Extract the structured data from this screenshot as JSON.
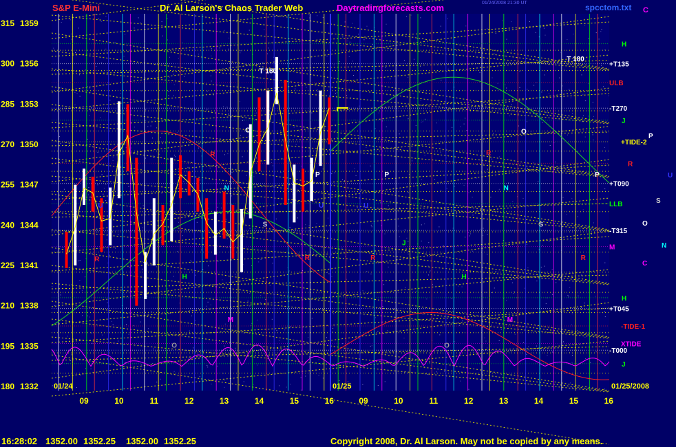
{
  "header": {
    "instrument": "S&P E-Mini",
    "title": "Dr. Al Larson's Chaos Trader Web",
    "site": "Daytradingforecasts.com",
    "timestamp": "01/24/2008 21:30 UT",
    "file": "spcctom.txt",
    "corner_letter": "C"
  },
  "footer": {
    "time": "16:28:02",
    "open": "1352.00",
    "high": "1352.25",
    "low": "1352.00",
    "close": "1352.25",
    "copyright": "Copyright 2008, Dr. Al Larson. May not be copied by any means."
  },
  "chart_data": {
    "type": "line",
    "y_axis_degree_labels": [
      "315",
      "300",
      "285",
      "270",
      "255",
      "240",
      "225",
      "210",
      "195",
      "180"
    ],
    "y_axis_price_labels": [
      "1359",
      "1356",
      "1353",
      "1350",
      "1347",
      "1344",
      "1341",
      "1338",
      "1335",
      "1332"
    ],
    "ylim": [
      1332,
      1359
    ],
    "x_tick_labels_day1": [
      "09",
      "10",
      "11",
      "12",
      "13",
      "14",
      "15",
      "16"
    ],
    "x_tick_labels_day2": [
      "09",
      "10",
      "11",
      "12",
      "13",
      "14",
      "15",
      "16"
    ],
    "date_labels": [
      "01/24",
      "01/25",
      "01/25/2008"
    ],
    "right_levels": [
      {
        "label": "H",
        "price": 1357.5,
        "color": "#00ff00"
      },
      {
        "label": "+T135",
        "price": 1356.0,
        "color": "#ffffff"
      },
      {
        "label": "ULB",
        "price": 1354.6,
        "color": "#ff2020"
      },
      {
        "label": "-T270",
        "price": 1352.7,
        "color": "#ffffff"
      },
      {
        "label": "J",
        "price": 1351.8,
        "color": "#00ff00"
      },
      {
        "label": "+TIDE-2",
        "price": 1350.2,
        "color": "#ffff00"
      },
      {
        "label": "R",
        "price": 1348.6,
        "color": "#ff2020"
      },
      {
        "label": "+T090",
        "price": 1347.1,
        "color": "#ffffff"
      },
      {
        "label": "LLB",
        "price": 1345.6,
        "color": "#00ff00"
      },
      {
        "label": "-T315",
        "price": 1343.6,
        "color": "#ffffff"
      },
      {
        "label": "M",
        "price": 1342.4,
        "color": "#ff00ff"
      },
      {
        "label": "H",
        "price": 1338.6,
        "color": "#00ff00"
      },
      {
        "label": "+T045",
        "price": 1337.8,
        "color": "#ffffff"
      },
      {
        "label": "-TIDE-1",
        "price": 1336.5,
        "color": "#ff2020"
      },
      {
        "label": "XTIDE",
        "price": 1335.2,
        "color": "#ff00ff"
      },
      {
        "label": "-T000",
        "price": 1334.7,
        "color": "#ffffff"
      },
      {
        "label": "J",
        "price": 1333.7,
        "color": "#00ff00"
      }
    ],
    "outside_markers": [
      {
        "label": "P",
        "color": "#ffffff"
      },
      {
        "label": "U",
        "color": "#3333ff"
      },
      {
        "label": "S",
        "color": "#cccccc"
      },
      {
        "label": "O",
        "color": "#ffffff"
      },
      {
        "label": "N",
        "color": "#00ffff"
      },
      {
        "label": "C",
        "color": "#ff00ff"
      }
    ],
    "chart_markers": [
      {
        "label": "T 180",
        "day": 1,
        "hour": 14.0,
        "price": 1355.3,
        "color": "#ffffff"
      },
      {
        "label": "T 180",
        "day": 2,
        "hour": 14.8,
        "price": 1356.2,
        "color": "#ffffff"
      },
      {
        "label": "O",
        "day": 1,
        "hour": 13.6,
        "price": 1350.9,
        "color": "#ffffff"
      },
      {
        "label": "O",
        "day": 2,
        "hour": 13.5,
        "price": 1350.8,
        "color": "#ffffff"
      },
      {
        "label": "N",
        "day": 1,
        "hour": 13.0,
        "price": 1346.6,
        "color": "#00ffff"
      },
      {
        "label": "N",
        "day": 2,
        "hour": 13.0,
        "price": 1346.6,
        "color": "#00ffff"
      },
      {
        "label": "P",
        "day": 1,
        "hour": 15.6,
        "price": 1347.6,
        "color": "#ffffff"
      },
      {
        "label": "P",
        "day": 2,
        "hour": 9.6,
        "price": 1347.6,
        "color": "#ffffff"
      },
      {
        "label": "P",
        "day": 2,
        "hour": 15.6,
        "price": 1347.6,
        "color": "#ffffff"
      },
      {
        "label": "S",
        "day": 1,
        "hour": 14.1,
        "price": 1343.9,
        "color": "#cccccc"
      },
      {
        "label": "S",
        "day": 2,
        "hour": 14.0,
        "price": 1343.9,
        "color": "#cccccc"
      },
      {
        "label": "R",
        "day": 1,
        "hour": 9.3,
        "price": 1341.3,
        "color": "#ff2020"
      },
      {
        "label": "R",
        "day": 1,
        "hour": 12.6,
        "price": 1349.1,
        "color": "#ff2020"
      },
      {
        "label": "R",
        "day": 1,
        "hour": 15.3,
        "price": 1341.4,
        "color": "#ff2020"
      },
      {
        "label": "R",
        "day": 2,
        "hour": 9.2,
        "price": 1341.4,
        "color": "#ff2020"
      },
      {
        "label": "R",
        "day": 2,
        "hour": 12.5,
        "price": 1349.2,
        "color": "#ff2020"
      },
      {
        "label": "R",
        "day": 2,
        "hour": 15.2,
        "price": 1341.4,
        "color": "#ff2020"
      },
      {
        "label": "H",
        "day": 1,
        "hour": 11.8,
        "price": 1340.0,
        "color": "#00ff00"
      },
      {
        "label": "H",
        "day": 2,
        "hour": 11.8,
        "price": 1340.0,
        "color": "#00ff00"
      },
      {
        "label": "M",
        "day": 1,
        "hour": 13.1,
        "price": 1336.8,
        "color": "#ff00ff"
      },
      {
        "label": "M",
        "day": 2,
        "hour": 13.1,
        "price": 1336.8,
        "color": "#ff00ff"
      },
      {
        "label": "J",
        "day": 2,
        "hour": 10.1,
        "price": 1342.5,
        "color": "#00ff00"
      },
      {
        "label": "U",
        "day": 1,
        "hour": 9.4,
        "price": 1345.3,
        "color": "#3333ff"
      },
      {
        "label": "U",
        "day": 1,
        "hour": 15.7,
        "price": 1345.3,
        "color": "#3333ff"
      },
      {
        "label": "U",
        "day": 2,
        "hour": 9.0,
        "price": 1345.3,
        "color": "#3333ff"
      },
      {
        "label": "O",
        "day": 1,
        "hour": 11.5,
        "price": 1334.9,
        "color": "#999999"
      },
      {
        "label": "O",
        "day": 2,
        "hour": 11.3,
        "price": 1334.9,
        "color": "#999999"
      }
    ],
    "price_series": [
      {
        "hour": 8.5,
        "open": 1342.5,
        "high": 1343.5,
        "low": 1340.8,
        "close": 1341.2
      },
      {
        "hour": 8.75,
        "open": 1341.2,
        "high": 1347.0,
        "low": 1341.0,
        "close": 1346.5
      },
      {
        "hour": 9.0,
        "open": 1346.5,
        "high": 1348.2,
        "low": 1345.5,
        "close": 1347.0
      },
      {
        "hour": 9.25,
        "open": 1347.0,
        "high": 1347.6,
        "low": 1345.0,
        "close": 1345.8
      },
      {
        "hour": 9.5,
        "open": 1345.8,
        "high": 1346.0,
        "low": 1342.0,
        "close": 1342.8
      },
      {
        "hour": 9.75,
        "open": 1342.8,
        "high": 1346.8,
        "low": 1342.5,
        "close": 1346.2
      },
      {
        "hour": 10.0,
        "open": 1346.2,
        "high": 1353.2,
        "low": 1346.0,
        "close": 1352.5
      },
      {
        "hour": 10.25,
        "open": 1352.5,
        "high": 1353.0,
        "low": 1348.0,
        "close": 1348.8
      },
      {
        "hour": 10.5,
        "open": 1348.8,
        "high": 1349.0,
        "low": 1338.0,
        "close": 1341.0
      },
      {
        "hour": 10.75,
        "open": 1341.0,
        "high": 1342.0,
        "low": 1338.5,
        "close": 1341.5
      },
      {
        "hour": 11.0,
        "open": 1341.5,
        "high": 1346.0,
        "low": 1341.0,
        "close": 1345.2
      },
      {
        "hour": 11.25,
        "open": 1345.2,
        "high": 1345.5,
        "low": 1342.5,
        "close": 1343.0
      },
      {
        "hour": 11.5,
        "open": 1343.0,
        "high": 1349.0,
        "low": 1342.8,
        "close": 1348.0
      },
      {
        "hour": 11.75,
        "open": 1348.0,
        "high": 1349.2,
        "low": 1346.0,
        "close": 1347.5
      },
      {
        "hour": 12.0,
        "open": 1347.5,
        "high": 1348.0,
        "low": 1346.2,
        "close": 1346.8
      },
      {
        "hour": 12.25,
        "open": 1346.8,
        "high": 1347.5,
        "low": 1345.0,
        "close": 1345.8
      },
      {
        "hour": 12.5,
        "open": 1345.8,
        "high": 1346.0,
        "low": 1341.5,
        "close": 1342.5
      },
      {
        "hour": 12.75,
        "open": 1342.5,
        "high": 1345.0,
        "low": 1341.8,
        "close": 1344.0
      },
      {
        "hour": 13.0,
        "open": 1344.0,
        "high": 1346.5,
        "low": 1343.0,
        "close": 1343.5
      },
      {
        "hour": 13.25,
        "open": 1343.5,
        "high": 1345.5,
        "low": 1341.5,
        "close": 1342.0
      },
      {
        "hour": 13.5,
        "open": 1342.0,
        "high": 1345.2,
        "low": 1340.5,
        "close": 1344.8
      },
      {
        "hour": 13.75,
        "open": 1344.8,
        "high": 1351.5,
        "low": 1344.5,
        "close": 1351.0
      },
      {
        "hour": 14.0,
        "open": 1351.0,
        "high": 1353.5,
        "low": 1348.0,
        "close": 1349.0
      },
      {
        "hour": 14.25,
        "open": 1349.0,
        "high": 1354.0,
        "low": 1348.5,
        "close": 1353.5
      },
      {
        "hour": 14.5,
        "open": 1353.5,
        "high": 1356.5,
        "low": 1353.0,
        "close": 1354.2
      },
      {
        "hour": 14.75,
        "open": 1354.2,
        "high": 1354.8,
        "low": 1345.5,
        "close": 1346.5
      },
      {
        "hour": 15.0,
        "open": 1346.5,
        "high": 1348.5,
        "low": 1344.2,
        "close": 1347.8
      },
      {
        "hour": 15.25,
        "open": 1347.8,
        "high": 1348.2,
        "low": 1345.0,
        "close": 1346.0
      },
      {
        "hour": 15.5,
        "open": 1346.0,
        "high": 1349.0,
        "low": 1345.8,
        "close": 1348.6
      },
      {
        "hour": 15.75,
        "open": 1348.6,
        "high": 1354.0,
        "low": 1348.4,
        "close": 1353.2
      },
      {
        "hour": 16.0,
        "open": 1353.2,
        "high": 1353.5,
        "low": 1350.0,
        "close": 1352.25
      }
    ]
  }
}
